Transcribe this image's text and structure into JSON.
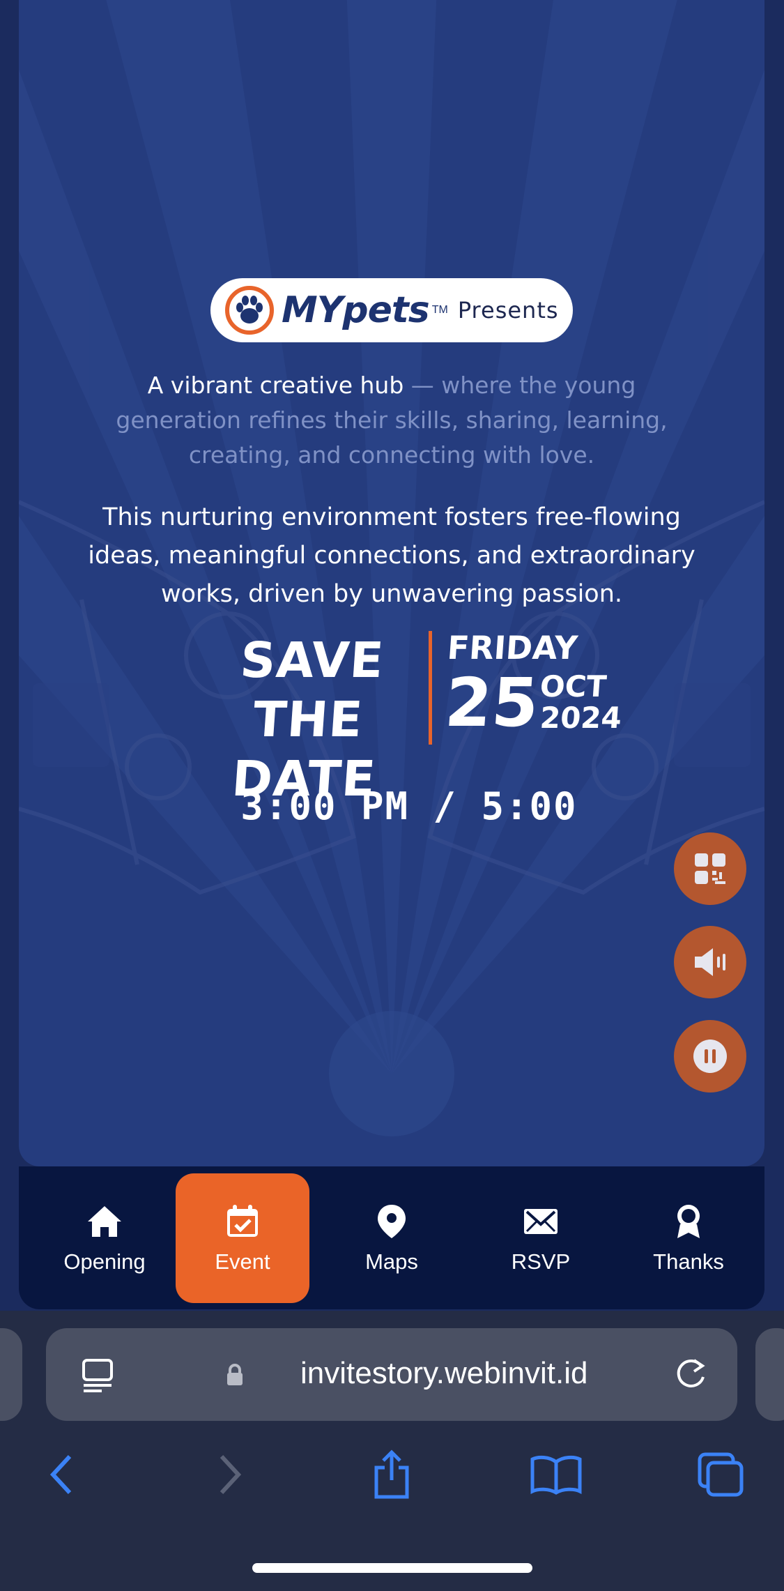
{
  "brand": {
    "name": "MYpets",
    "tm": "TM",
    "presents": "Presents"
  },
  "intro": {
    "lead": "A vibrant creative hub",
    "rest": " — where the young generation refines their skills, sharing, learning, creating, and connecting with love."
  },
  "body": "This nurturing environment fosters free-flowing ideas, meaningful connections, and extraordinary works, driven by unwavering passion.",
  "save_date": {
    "line1": "SAVE THE",
    "line2": "DATE",
    "day": "FRIDAY",
    "date": "25",
    "month": "OCT",
    "year": "2024"
  },
  "time": "3:00 PM / 5:00",
  "fabs": [
    "qr-code-icon",
    "speaker-icon",
    "pause-icon"
  ],
  "nav": {
    "items": [
      {
        "label": "Opening",
        "icon": "home-icon"
      },
      {
        "label": "Event",
        "icon": "calendar-check-icon",
        "active": true
      },
      {
        "label": "Maps",
        "icon": "map-pin-icon"
      },
      {
        "label": "RSVP",
        "icon": "envelope-icon"
      },
      {
        "label": "Thanks",
        "icon": "award-icon"
      }
    ]
  },
  "browser": {
    "url": "invitestory.webinvit.id"
  },
  "colors": {
    "accent": "#ea6428",
    "card": "#253c7e",
    "nav": "#081640"
  }
}
